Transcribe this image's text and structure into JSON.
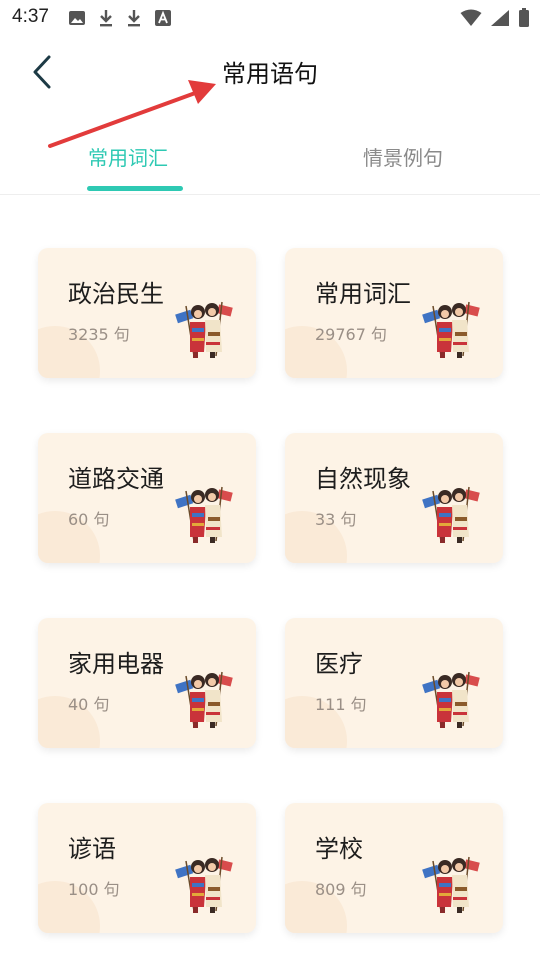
{
  "status_bar": {
    "time": "4:37",
    "left_icons": [
      "image-icon",
      "download-icon",
      "download-icon",
      "text-icon"
    ],
    "right_icons": [
      "wifi-icon",
      "signal-icon",
      "battery-icon"
    ]
  },
  "header": {
    "title": "常用语句",
    "back_icon": "chevron-left-icon"
  },
  "tabs": [
    {
      "label": "常用词汇",
      "active": true
    },
    {
      "label": "情景例句",
      "active": false
    }
  ],
  "colors": {
    "accent": "#2ec9b3",
    "card_bg": "#fdf3e6",
    "annotation_arrow": "#e23b3b"
  },
  "categories": [
    {
      "title": "政治民生",
      "count": "3235 句"
    },
    {
      "title": "常用词汇",
      "count": "29767 句"
    },
    {
      "title": "道路交通",
      "count": "60 句"
    },
    {
      "title": "自然现象",
      "count": "33 句"
    },
    {
      "title": "家用电器",
      "count": "40 句"
    },
    {
      "title": "医疗",
      "count": "111 句"
    },
    {
      "title": "谚语",
      "count": "100 句"
    },
    {
      "title": "学校",
      "count": "809 句"
    }
  ]
}
